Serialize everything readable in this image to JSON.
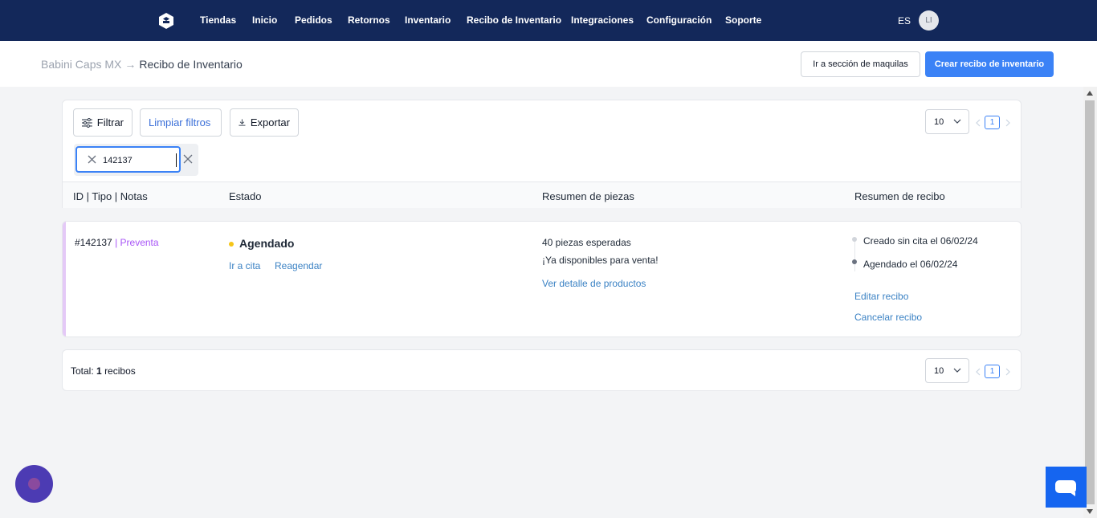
{
  "nav": {
    "items": [
      "Tiendas",
      "Inicio",
      "Pedidos",
      "Retornos",
      "Inventario",
      "Recibo de Inventario",
      "Integraciones",
      "Configuración",
      "Soporte"
    ],
    "language": "ES",
    "avatar_initials": "LI"
  },
  "header": {
    "store": "Babini Caps MX",
    "arrow": "→",
    "page": "Recibo de Inventario",
    "maquilas_button": "Ir a sección de maquilas",
    "create_button": "Crear recibo de inventario"
  },
  "filters": {
    "filter_label": "Filtrar",
    "clear_label": "Limpiar filtros",
    "export_label": "Exportar",
    "search_value": "142137",
    "page_size": "10",
    "current_page": "1"
  },
  "table": {
    "headers": [
      "ID | Tipo | Notas",
      "Estado",
      "Resumen de piezas",
      "Resumen de recibo"
    ]
  },
  "row": {
    "id": "#142137",
    "type": "| Preventa",
    "status": "Agendado",
    "go_to_appointment": "Ir a cita",
    "reschedule": "Reagendar",
    "pieces_expected": "40 piezas esperadas",
    "available_note": "¡Ya disponibles para venta!",
    "product_detail_link": "Ver detalle de productos",
    "timeline": [
      "Creado sin cita el 06/02/24",
      "Agendado el 06/02/24"
    ],
    "edit_link": "Editar recibo",
    "cancel_link": "Cancelar recibo"
  },
  "footer": {
    "total_prefix": "Total:",
    "total_count": "1",
    "total_suffix": "recibos",
    "page_size": "10",
    "current_page": "1"
  },
  "colors": {
    "navbar": "#13285a",
    "primary": "#3b82f6",
    "link": "#3b82c4",
    "preventa": "#a855f7",
    "status_dot": "#f5c518",
    "row_accent": "#e4c9f7"
  }
}
